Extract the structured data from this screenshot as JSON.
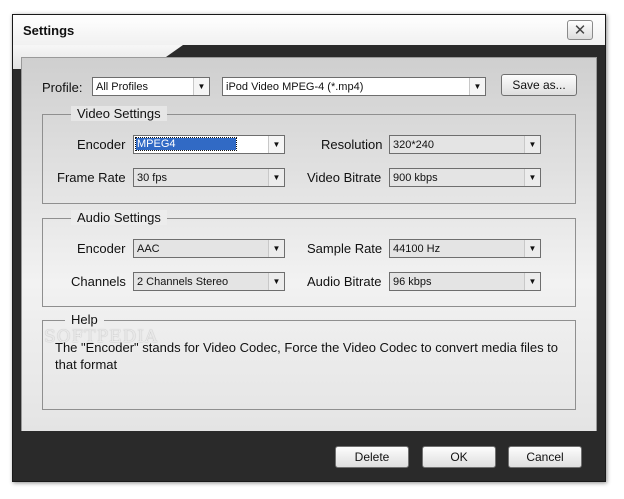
{
  "window": {
    "title": "Settings",
    "close_glyph": "✕"
  },
  "profile": {
    "label": "Profile:",
    "category": "All Profiles",
    "format": "iPod Video MPEG-4 (*.mp4)",
    "save_as_label": "Save as..."
  },
  "video_settings": {
    "title": "Video Settings",
    "encoder_label": "Encoder",
    "encoder_value": "MPEG4",
    "resolution_label": "Resolution",
    "resolution_value": "320*240",
    "frame_rate_label": "Frame Rate",
    "frame_rate_value": "30 fps",
    "video_bitrate_label": "Video Bitrate",
    "video_bitrate_value": "900 kbps"
  },
  "audio_settings": {
    "title": "Audio Settings",
    "encoder_label": "Encoder",
    "encoder_value": "AAC",
    "sample_rate_label": "Sample Rate",
    "sample_rate_value": "44100 Hz",
    "channels_label": "Channels",
    "channels_value": "2 Channels Stereo",
    "audio_bitrate_label": "Audio Bitrate",
    "audio_bitrate_value": "96 kbps"
  },
  "help": {
    "title": "Help",
    "text": "The \"Encoder\" stands for Video Codec, Force the Video Codec to convert media files to that format"
  },
  "watermark": "SOFTPEDIA",
  "buttons": {
    "delete": "Delete",
    "ok": "OK",
    "cancel": "Cancel"
  },
  "icons": {
    "dropdown": "chevron-down-icon",
    "close": "close-icon"
  },
  "colors": {
    "selection": "#316ac5",
    "frame": "#2a2a2a"
  }
}
